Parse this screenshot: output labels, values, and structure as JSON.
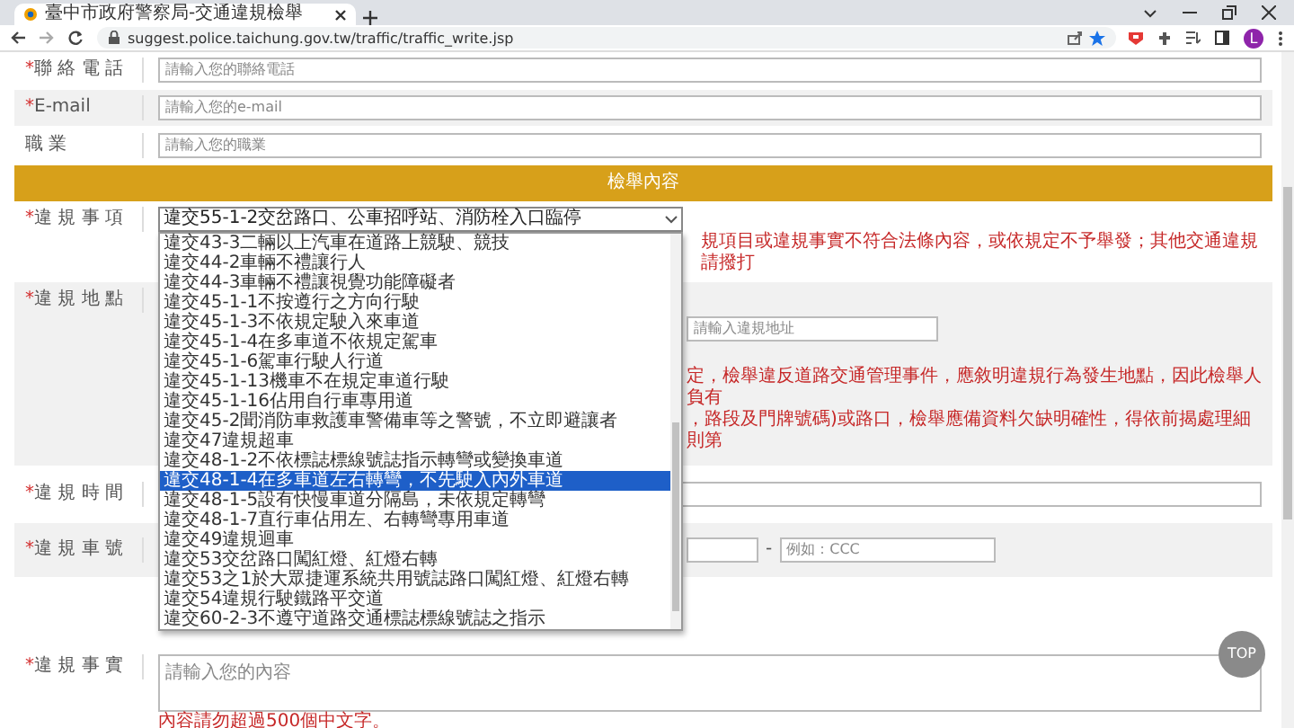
{
  "browser": {
    "tab_title": "臺中市政府警察局-交通違規檢舉",
    "url": "suggest.police.taichung.gov.tw/traffic/traffic_write.jsp",
    "profile_initial": "L"
  },
  "contact_rows": [
    {
      "label": "聯 絡 電 話",
      "required": true,
      "placeholder": "請輸入您的聯絡電話"
    },
    {
      "label": "E-mail",
      "required": true,
      "placeholder": "請輸入您的e-mail"
    },
    {
      "label": "職 業",
      "required": false,
      "placeholder": "請輸入您的職業"
    }
  ],
  "required_mark": "*",
  "section_title": "檢舉內容",
  "violation_item": {
    "label": "違 規 事 項",
    "required": true,
    "value": "違交55-1-2交岔路口、公車招呼站、消防栓入口臨停",
    "note": "規項目或違規事實不符合法條內容，或依規定不予舉發；其他交通違規請撥打"
  },
  "dropdown": {
    "options": [
      {
        "label": "違交43-3二輛以上汽車在道路上競駛、競技",
        "selected": false
      },
      {
        "label": "違交44-2車輛不禮讓行人",
        "selected": false
      },
      {
        "label": "違交44-3車輛不禮讓視覺功能障礙者",
        "selected": false
      },
      {
        "label": "違交45-1-1不按遵行之方向行駛",
        "selected": false
      },
      {
        "label": "違交45-1-3不依規定駛入來車道",
        "selected": false
      },
      {
        "label": "違交45-1-4在多車道不依規定駕車",
        "selected": false
      },
      {
        "label": "違交45-1-6駕車行駛人行道",
        "selected": false
      },
      {
        "label": "違交45-1-13機車不在規定車道行駛",
        "selected": false
      },
      {
        "label": "違交45-1-16佔用自行車專用道",
        "selected": false
      },
      {
        "label": "違交45-2聞消防車救護車警備車等之警號，不立即避讓者",
        "selected": false
      },
      {
        "label": "違交47違規超車",
        "selected": false
      },
      {
        "label": "違交48-1-2不依標誌標線號誌指示轉彎或變換車道",
        "selected": false
      },
      {
        "label": "違交48-1-4在多車道左右轉彎，不先駛入內外車道",
        "selected": true
      },
      {
        "label": "違交48-1-5設有快慢車道分隔島，未依規定轉彎",
        "selected": false
      },
      {
        "label": "違交48-1-7直行車佔用左、右轉彎專用車道",
        "selected": false
      },
      {
        "label": "違交49違規迴車",
        "selected": false
      },
      {
        "label": "違交53交岔路口闖紅燈、紅燈右轉",
        "selected": false
      },
      {
        "label": "違交53之1於大眾捷運系統共用號誌路口闖紅燈、紅燈右轉",
        "selected": false
      },
      {
        "label": "違交54違規行駛鐵路平交道",
        "selected": false
      },
      {
        "label": "違交60-2-3不遵守道路交通標誌標線號誌之指示",
        "selected": false
      }
    ]
  },
  "location": {
    "label": "違 規 地 點",
    "required": true,
    "address_placeholder": "請輸入違規地址",
    "notes": [
      "定，檢舉違反道路交通管理事件，應敘明違規行為發生地點，因此檢舉人負有",
      "，路段及門牌號碼)或路口，檢舉應備資料欠缺明確性，得依前揭處理細則第"
    ]
  },
  "time": {
    "label": "違 規 時 間",
    "required": true
  },
  "plate": {
    "label": "違 規 車 號",
    "required": true,
    "separator": "-",
    "suffix_placeholder": "例如：CCC"
  },
  "facts": {
    "label": "違 規 事 實",
    "required": true,
    "placeholder": "請輸入您的內容",
    "hint": "內容請勿超過500個中文字。"
  },
  "top_button": "TOP"
}
